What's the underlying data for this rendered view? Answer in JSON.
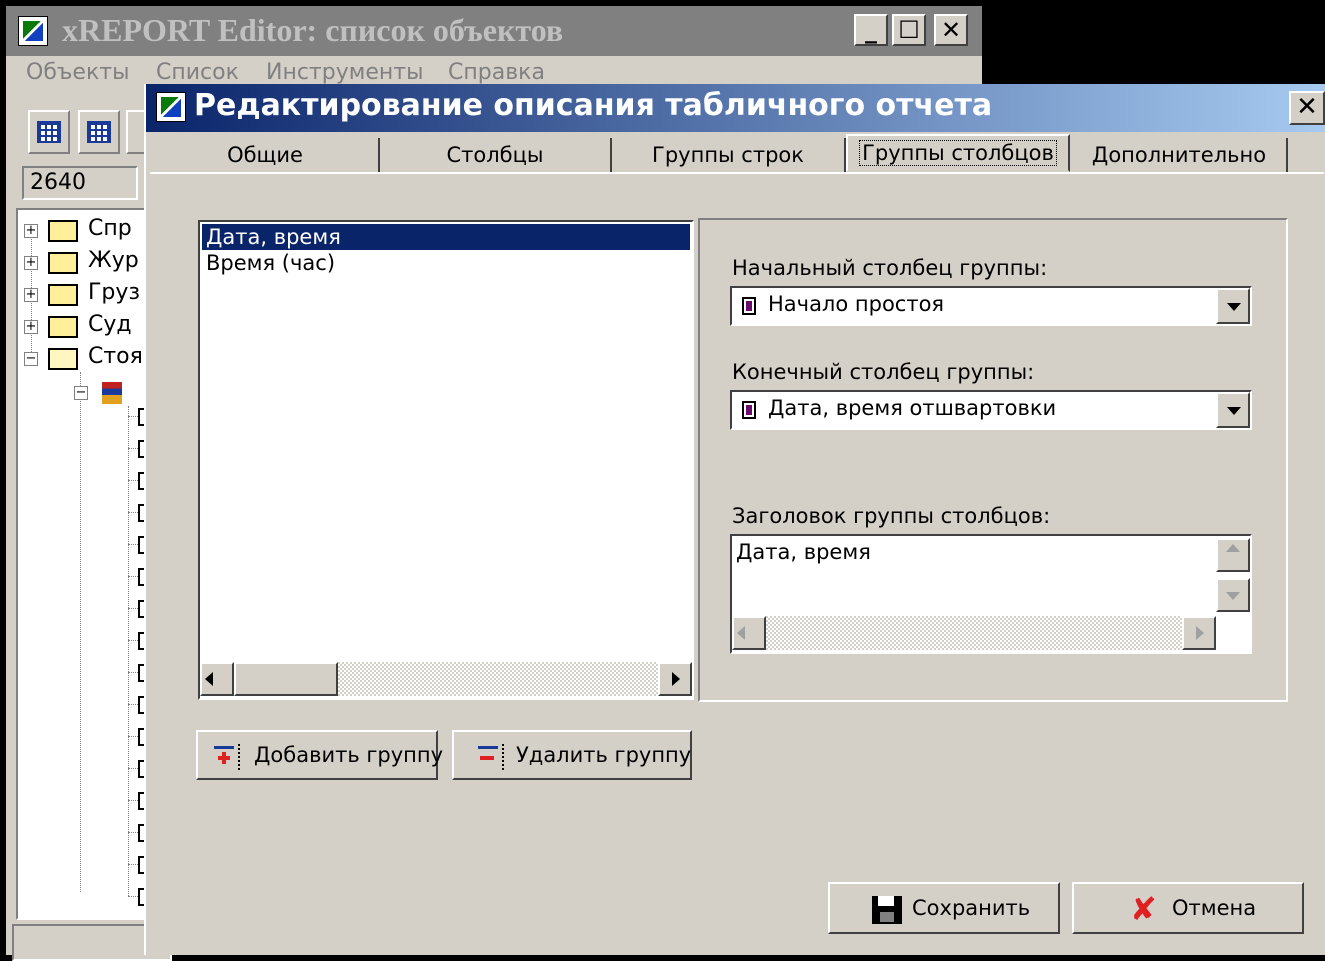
{
  "main_window": {
    "title": "xREPORT Editor: список объектов",
    "controls": {
      "minimize": "_",
      "maximize": "☐",
      "close": "✕"
    },
    "menu": [
      "Объекты",
      "Список",
      "Инструменты",
      "Справка"
    ],
    "filter_value": "2640",
    "tree": [
      {
        "label": "Спр",
        "expander": "+"
      },
      {
        "label": "Жур",
        "expander": "+"
      },
      {
        "label": "Груз",
        "expander": "+"
      },
      {
        "label": "Суд",
        "expander": "+"
      },
      {
        "label": "Стоя",
        "expander": "−",
        "expanded": true
      },
      {
        "label": "",
        "expander": "−",
        "child": true
      }
    ]
  },
  "dialog": {
    "title": "Редактирование описания табличного отчета",
    "close": "✕",
    "tabs": [
      "Общие",
      "Столбцы",
      "Группы строк",
      "Группы столбцов",
      "Дополнительно"
    ],
    "active_tab": "Группы столбцов",
    "groups": [
      "Дата, время",
      "Время (час)"
    ],
    "selected_group": "Дата, время",
    "start_column_label": "Начальный столбец группы:",
    "start_column_value": "Начало простоя",
    "end_column_label": "Конечный столбец группы:",
    "end_column_value": "Дата, время отшвартовки",
    "header_label": "Заголовок группы столбцов:",
    "header_value": "Дата, время",
    "add_group": "Добавить группу",
    "remove_group": "Удалить группу",
    "save": "Сохранить",
    "cancel": "Отмена"
  }
}
